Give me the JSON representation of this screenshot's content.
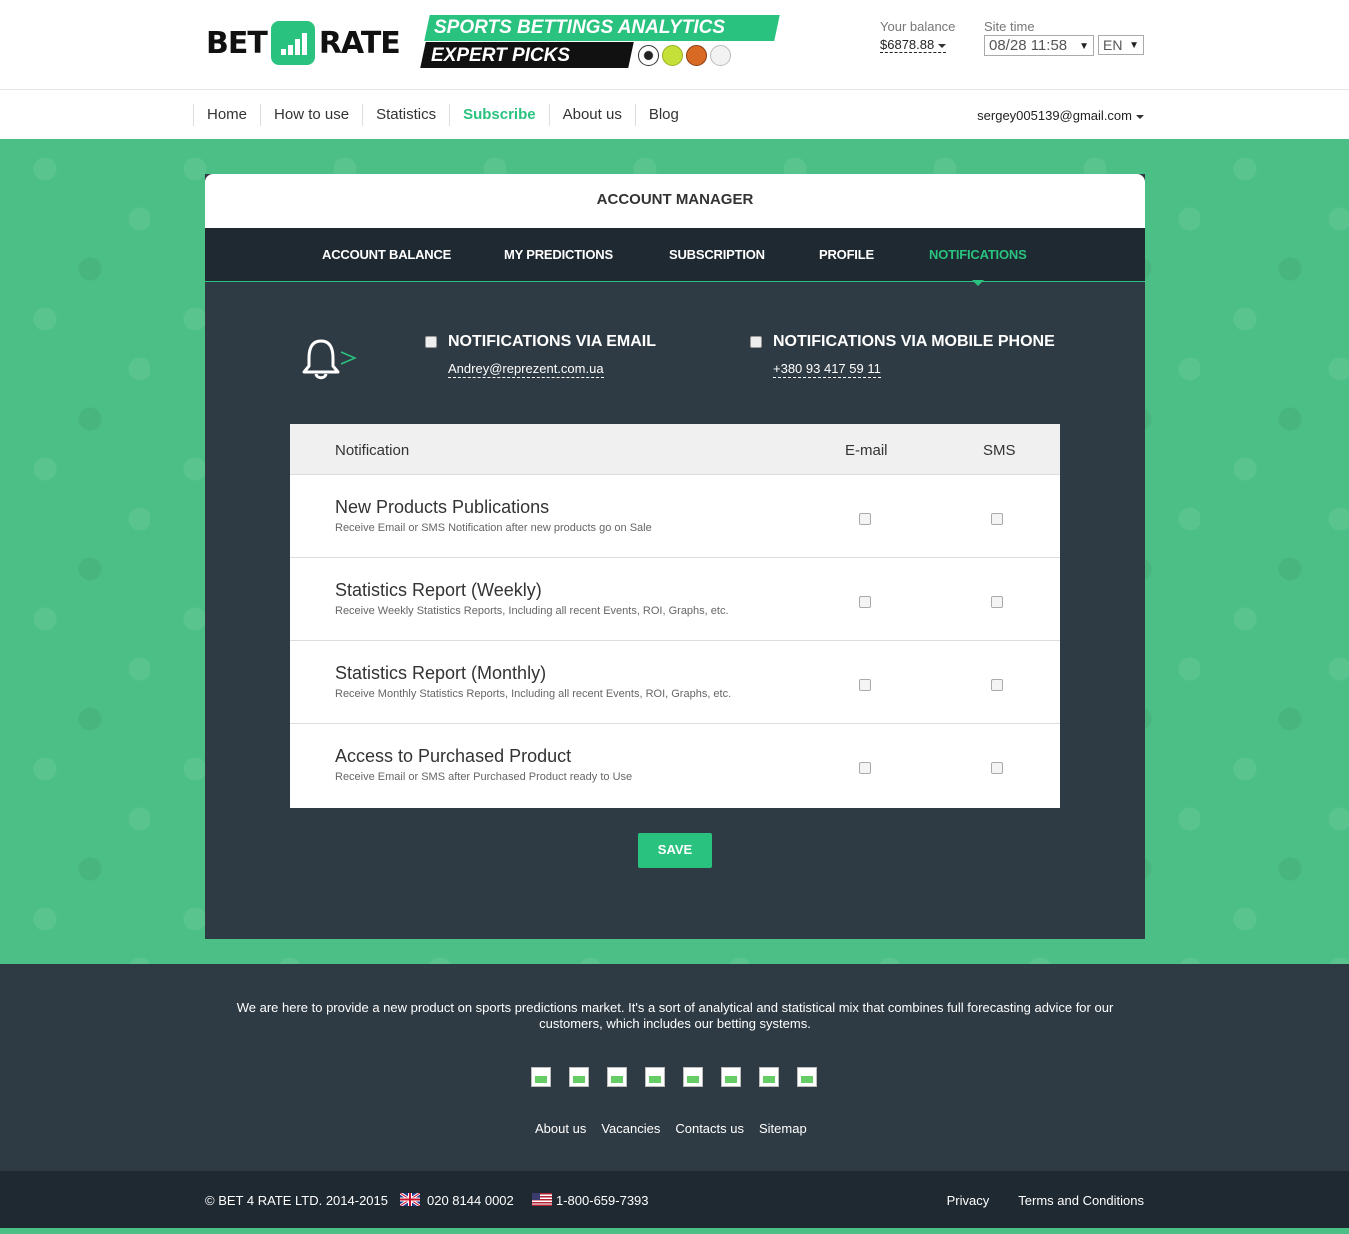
{
  "brand": {
    "logo_left": "BET",
    "logo_right": "RATE",
    "tagline_1": "SPORTS BETTINGS ANALYTICS",
    "tagline_2": "EXPERT PICKS"
  },
  "header": {
    "balance_label": "Your balance",
    "balance_value": "$6878.88",
    "time_label": "Site time",
    "time_value": "08/28 11:58",
    "language": "EN"
  },
  "nav": {
    "items": [
      {
        "label": "Home",
        "active": false
      },
      {
        "label": "How to use",
        "active": false
      },
      {
        "label": "Statistics",
        "active": false
      },
      {
        "label": "Subscribe",
        "active": true
      },
      {
        "label": "About us",
        "active": false
      },
      {
        "label": "Blog",
        "active": false
      }
    ],
    "user_email": "sergey005139@gmail.com"
  },
  "account": {
    "title": "ACCOUNT MANAGER",
    "tabs": [
      {
        "label": "ACCOUNT BALANCE",
        "active": false
      },
      {
        "label": "MY PREDICTIONS",
        "active": false
      },
      {
        "label": "SUBSCRIPTION",
        "active": false
      },
      {
        "label": "PROFILE",
        "active": false
      },
      {
        "label": "NOTIFICATIONS",
        "active": true
      }
    ],
    "email_option": {
      "label": "NOTIFICATIONS VIA EMAIL",
      "value": "Andrey@reprezent.com.ua"
    },
    "phone_option": {
      "label": "NOTIFICATIONS VIA MOBILE PHONE",
      "value": "+380 93 417 59 11"
    },
    "table": {
      "headers": [
        "Notification",
        "E-mail",
        "SMS"
      ],
      "rows": [
        {
          "title": "New Products Publications",
          "desc": "Receive Email or SMS Notification after new products go on Sale"
        },
        {
          "title": "Statistics Report (Weekly)",
          "desc": "Receive Weekly Statistics Reports, Including all recent Events, ROI, Graphs, etc."
        },
        {
          "title": "Statistics Report (Monthly)",
          "desc": "Receive Monthly Statistics Reports, Including all recent Events, ROI, Graphs, etc."
        },
        {
          "title": "Access to Purchased Product",
          "desc": "Receive Email or SMS after Purchased Product ready to Use"
        }
      ]
    },
    "save_label": "SAVE"
  },
  "footer": {
    "about_text": "We are here to provide a new product on sports predictions market. It's a sort of analytical and statistical mix that combines full forecasting advice for our customers, which includes our betting systems.",
    "links": [
      "About us",
      "Vacancies",
      "Contacts us",
      "Sitemap"
    ],
    "copyright": "© BET 4 RATE LTD. 2014-2015",
    "phone_uk": "020 8144 0002",
    "phone_us": "1-800-659-7393",
    "bottom_links": [
      "Privacy",
      "Terms and Conditions"
    ]
  },
  "colors": {
    "accent": "#29c27f",
    "dark": "#2f3b44",
    "darker": "#1f2931",
    "pattern_bg": "#4cbf86"
  }
}
